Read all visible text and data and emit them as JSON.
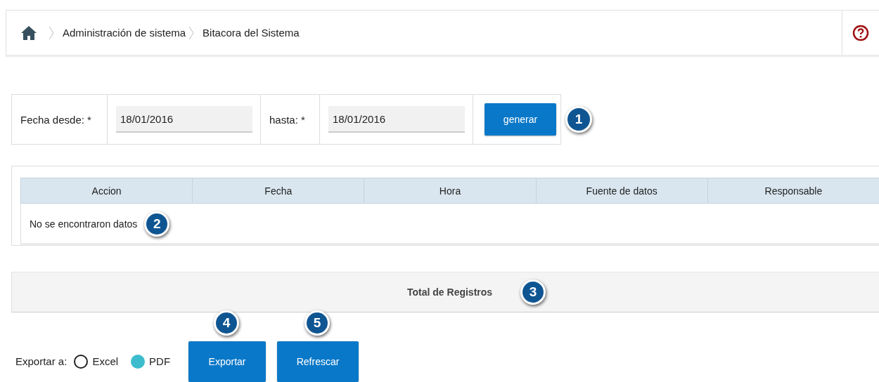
{
  "breadcrumb": {
    "items": [
      "Administración de sistema",
      "Bitacora del Sistema"
    ]
  },
  "filter": {
    "from_label": "Fecha desde: *",
    "from_value": "18/01/2016",
    "to_label": "hasta: *",
    "to_value": "18/01/2016",
    "button": "generar",
    "callout": "1"
  },
  "table": {
    "columns": [
      "Accion",
      "Fecha",
      "Hora",
      "Fuente de datos",
      "Responsable"
    ],
    "empty_message": "No se encontraron datos",
    "callout": "2"
  },
  "total": {
    "label": "Total de Registros",
    "callout": "3"
  },
  "export": {
    "label": "Exportar a:",
    "options": [
      {
        "label": "Excel",
        "selected": false
      },
      {
        "label": "PDF",
        "selected": true
      }
    ],
    "buttons": [
      {
        "label": "Exportar",
        "callout": "4"
      },
      {
        "label": "Refrescar",
        "callout": "5"
      }
    ]
  }
}
